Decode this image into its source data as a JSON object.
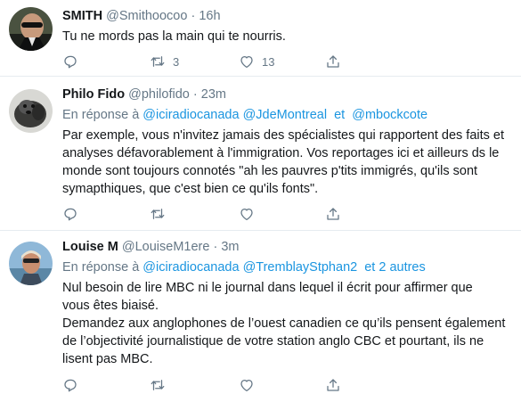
{
  "tweets": [
    {
      "name": "SMITH",
      "handle": "@Smithoocoo",
      "separator": "·",
      "time": "16h",
      "reply_prefix": "",
      "reply_mentions": [],
      "reply_joiner": "",
      "text": "Tu ne mords pas la main qui te nourris.",
      "reply_count": "",
      "retweet_count": "3",
      "like_count": "13"
    },
    {
      "name": "Philo Fido",
      "handle": "@philofido",
      "separator": "·",
      "time": "23m",
      "reply_prefix": "En réponse à",
      "reply_mentions": [
        "@iciradiocanada",
        "@JdeMontreal",
        "et",
        "@mbockcote"
      ],
      "text": "Par exemple, vous n'invitez jamais des spécialistes qui rapportent des faits et\nanalyses défavorablement à l'immigration. Vos reportages ici et ailleurs ds le\nmonde sont toujours connotés \"ah les pauvres p'tits immigrés, qu'ils sont\nsymapthiques, que c'est bien ce qu'ils fonts\".",
      "reply_count": "",
      "retweet_count": "",
      "like_count": ""
    },
    {
      "name": "Louise M",
      "handle": "@LouiseM1ere",
      "separator": "·",
      "time": "3m",
      "reply_prefix": "En réponse à",
      "reply_mentions": [
        "@iciradiocanada",
        "@TremblayStphan2",
        "et 2 autres"
      ],
      "text": "Nul besoin de lire MBC ni le journal dans lequel il écrit pour affirmer que\nvous êtes biaisé.\nDemandez aux anglophones de l’ouest canadien ce qu’ils pensent également\nde l’objectivité journalistique de votre station anglo CBC et pourtant, ils ne\nlisent pas MBC.",
      "reply_count": "",
      "retweet_count": "",
      "like_count": ""
    }
  ],
  "colors": {
    "text": "#14171a",
    "secondary": "#657786",
    "link": "#1b95e0",
    "divider": "#e6ecf0"
  },
  "icons": [
    "reply-icon",
    "retweet-icon",
    "like-icon",
    "share-icon"
  ]
}
